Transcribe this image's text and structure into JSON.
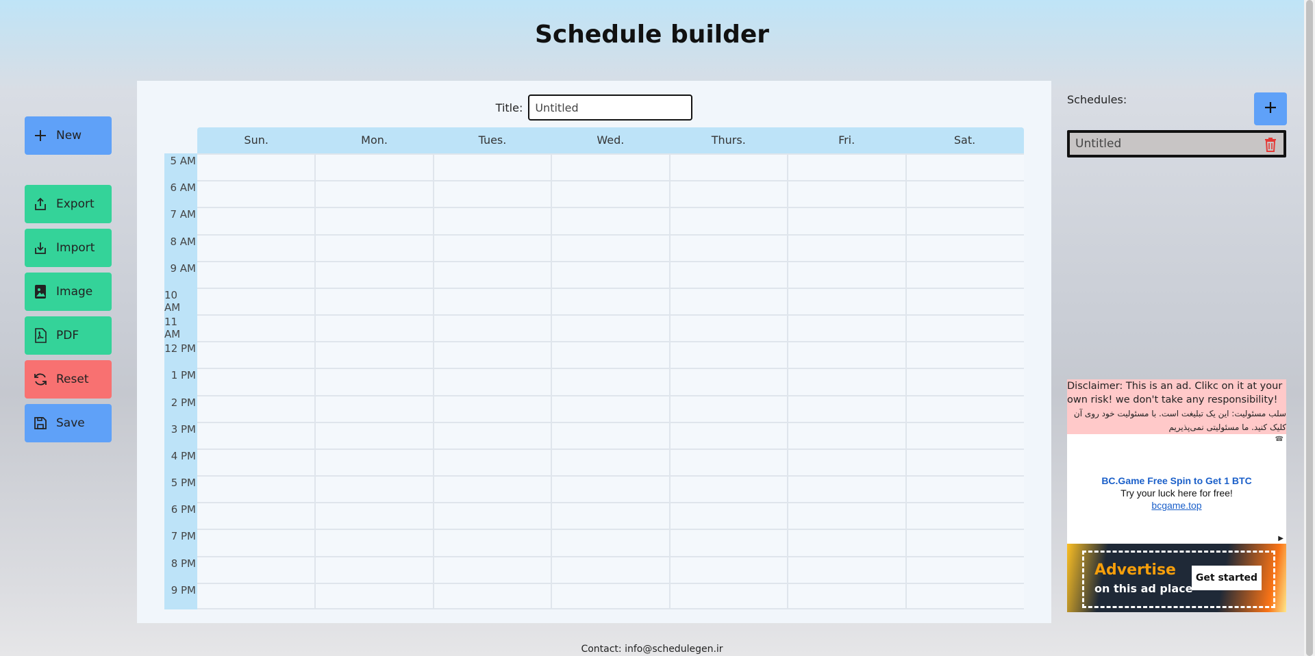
{
  "header": {
    "title": "Schedule builder"
  },
  "sidebar": {
    "buttons": [
      {
        "label": "New",
        "icon": "plus-icon"
      },
      {
        "label": "Export",
        "icon": "export-icon"
      },
      {
        "label": "Import",
        "icon": "import-icon"
      },
      {
        "label": "Image",
        "icon": "image-icon"
      },
      {
        "label": "PDF",
        "icon": "pdf-icon"
      },
      {
        "label": "Reset",
        "icon": "refresh-icon"
      },
      {
        "label": "Save",
        "icon": "save-icon"
      }
    ]
  },
  "main": {
    "title_label": "Title:",
    "title_value": "Untitled",
    "days": [
      "Sun.",
      "Mon.",
      "Tues.",
      "Wed.",
      "Thurs.",
      "Fri.",
      "Sat."
    ],
    "times": [
      "5 AM",
      "6 AM",
      "7 AM",
      "8 AM",
      "9 AM",
      "10 AM",
      "11 AM",
      "12 PM",
      "1 PM",
      "2 PM",
      "3 PM",
      "4 PM",
      "5 PM",
      "6 PM",
      "7 PM",
      "8 PM",
      "9 PM"
    ]
  },
  "right": {
    "schedules_label": "Schedules:",
    "schedules": [
      {
        "name": "Untitled"
      }
    ]
  },
  "ad": {
    "disclaimer_en": "Disclaimer: This is an ad. Clikc on it at your own risk! we don't take any responsibility!",
    "disclaimer_fa": "سلب مسئولیت: این یک تبلیغت است. با مسئولیت خود روی آن کلیک کنید. ما مسئولیتی نمی‌پذیریم",
    "title": "BC.Game Free Spin to Get 1 BTC",
    "subtitle": "Try your luck here for free!",
    "link": "bcgame.top",
    "banner_title": "Advertise",
    "banner_sub": "on this ad place",
    "banner_button": "Get started"
  },
  "footer": {
    "contact": "Contact: info@schedulegen.ir"
  },
  "colors": {
    "blue": "#5fa1f8",
    "green": "#34d399",
    "red": "#f87171",
    "grid_header": "#bde3f8"
  }
}
